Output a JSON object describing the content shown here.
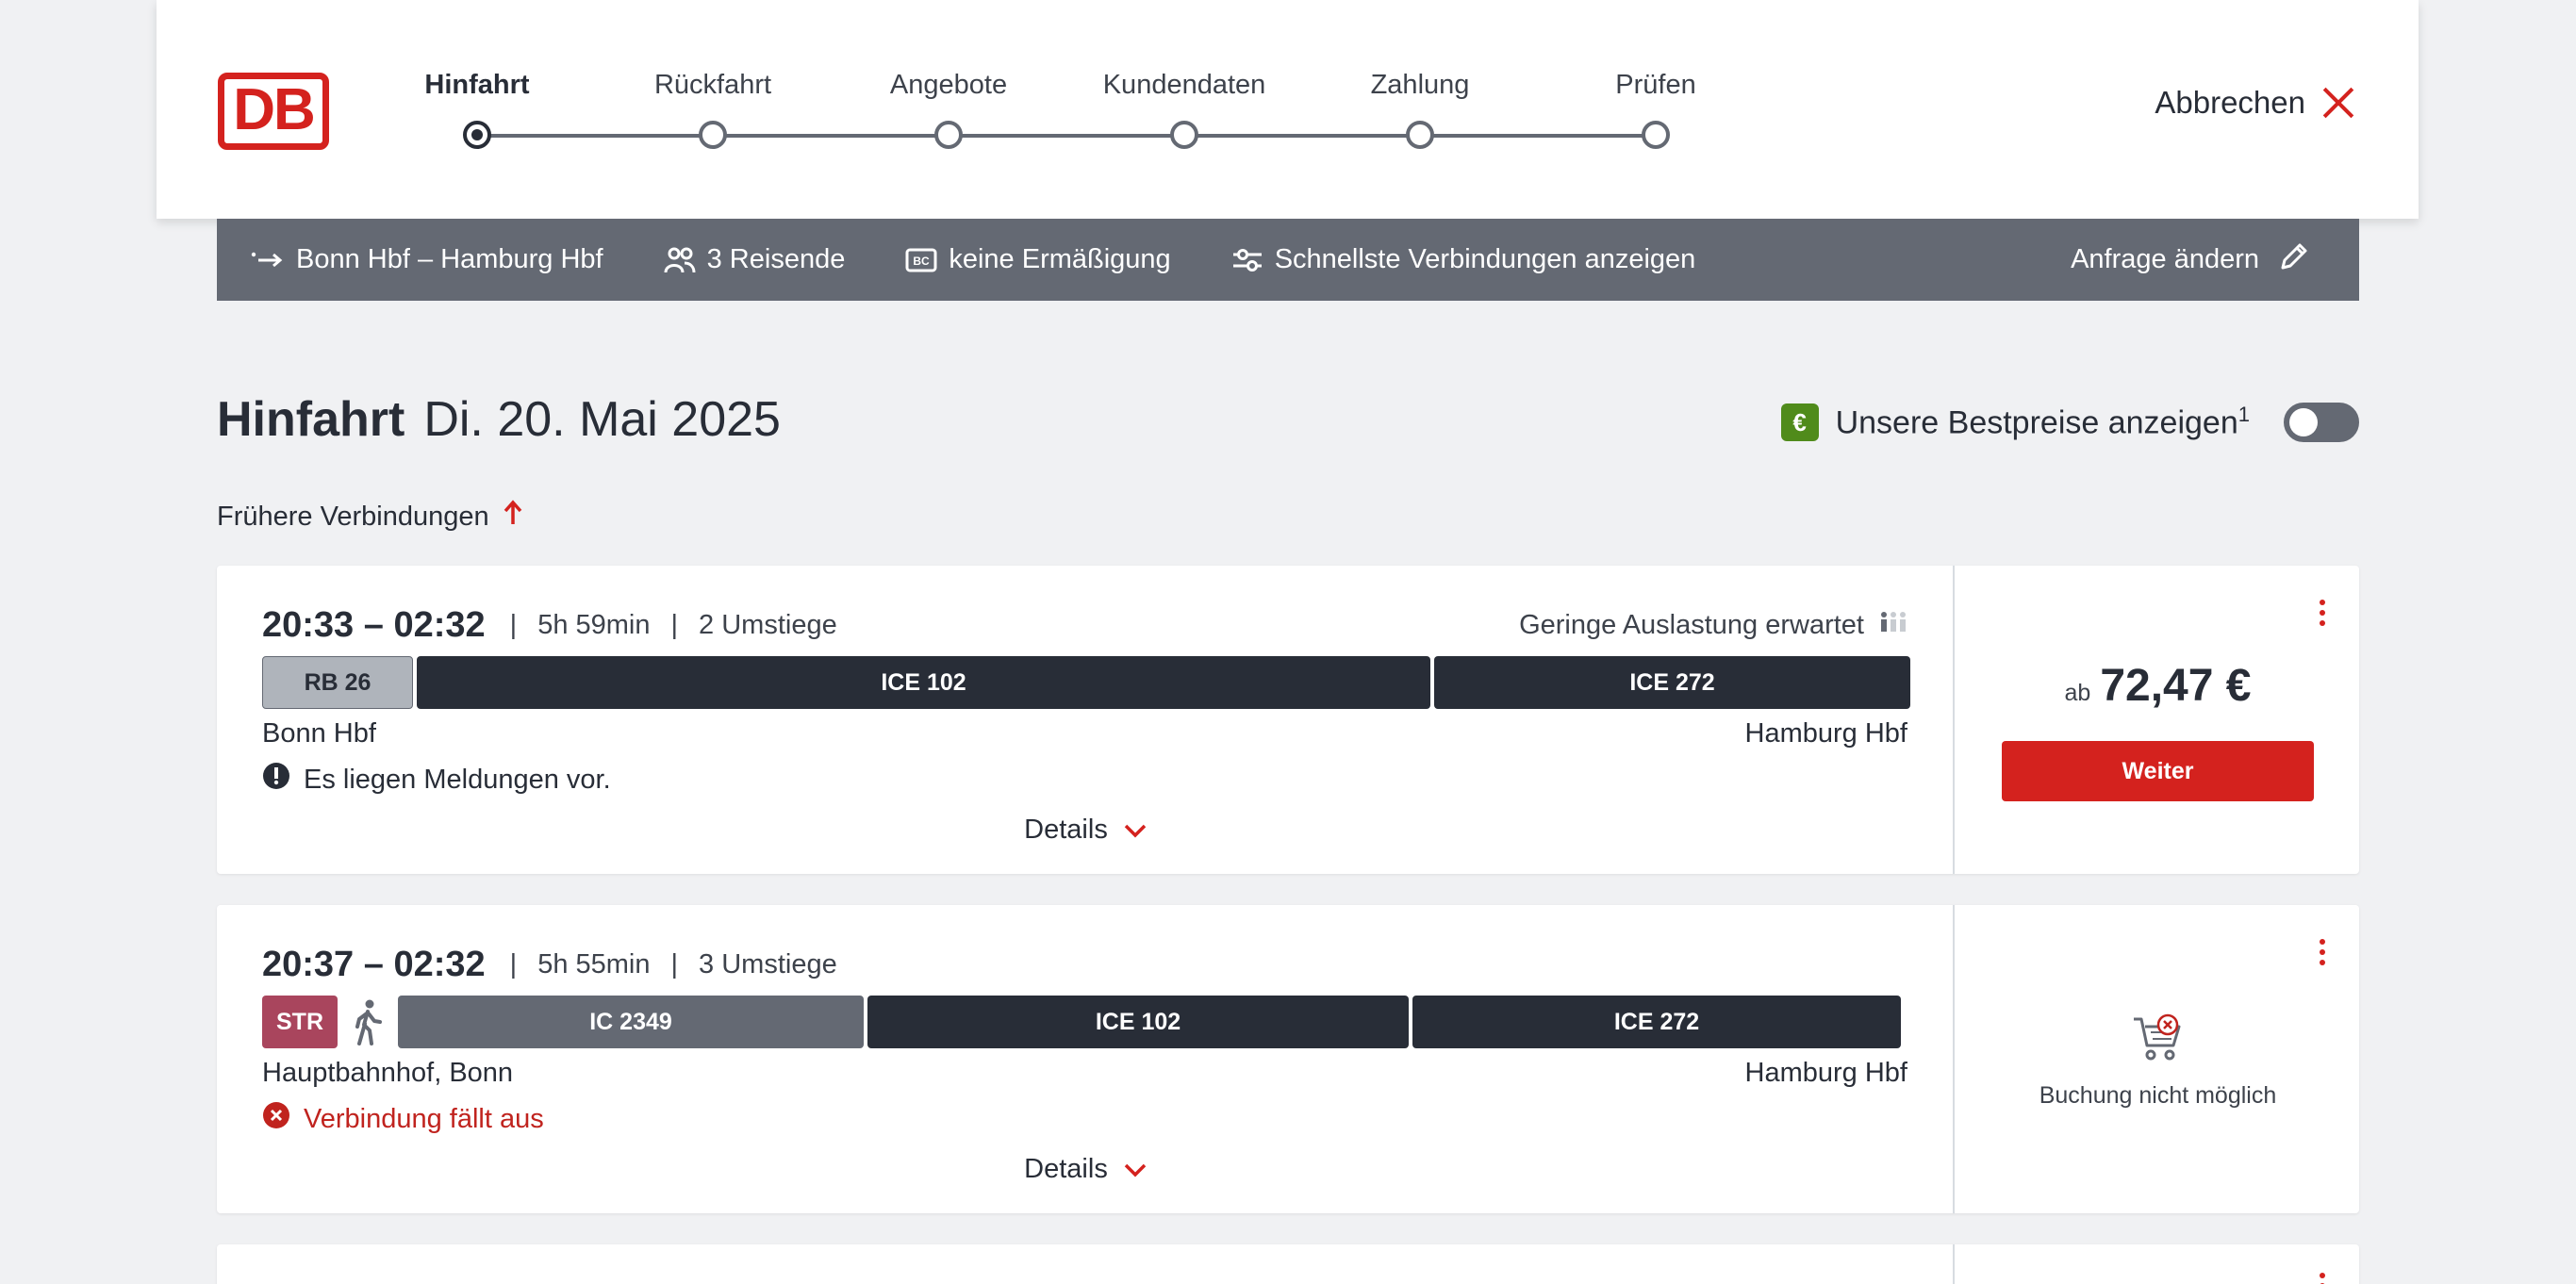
{
  "header": {
    "logo": "DB",
    "steps": [
      {
        "label": "Hinfahrt",
        "active": true
      },
      {
        "label": "Rückfahrt",
        "active": false
      },
      {
        "label": "Angebote",
        "active": false
      },
      {
        "label": "Kundendaten",
        "active": false
      },
      {
        "label": "Zahlung",
        "active": false
      },
      {
        "label": "Prüfen",
        "active": false
      }
    ],
    "cancel_label": "Abbrechen"
  },
  "query": {
    "route": "Bonn Hbf – Hamburg Hbf",
    "travellers": "3 Reisende",
    "discount": "keine Ermäßigung",
    "filter": "Schnellste Verbindungen anzeigen",
    "change_label": "Anfrage ändern"
  },
  "title": {
    "main": "Hinfahrt",
    "date": "Di. 20. Mai 2025",
    "bestprice_label": "Unsere Bestpreise anzeigen",
    "bestprice_sup": "1",
    "euro_symbol": "€"
  },
  "earlier_label": "Frühere Verbindungen",
  "connections": [
    {
      "times": "20:33 – 02:32",
      "duration": "5h 59min",
      "changes": "2 Umstiege",
      "occupancy": "Geringe Auslastung erwartet",
      "segments": [
        "RB 26",
        "ICE 102",
        "ICE 272"
      ],
      "from": "Bonn Hbf",
      "to": "Hamburg Hbf",
      "notice": "Es liegen Meldungen vor.",
      "details_label": "Details",
      "price_prefix": "ab",
      "price": "72,47 €",
      "button_label": "Weiter"
    },
    {
      "times": "20:37 – 02:32",
      "duration": "5h 55min",
      "changes": "3 Umstiege",
      "segments": [
        "STR",
        "IC 2349",
        "ICE 102",
        "ICE 272"
      ],
      "from": "Hauptbahnhof, Bonn",
      "to": "Hamburg Hbf",
      "notice": "Verbindung fällt aus",
      "details_label": "Details",
      "unavailable_label": "Buchung nicht möglich"
    }
  ],
  "colors": {
    "db_red": "#d4221e",
    "query_bar": "#646973",
    "bestprice_green": "#508b1b",
    "str_color": "#a9455d"
  }
}
